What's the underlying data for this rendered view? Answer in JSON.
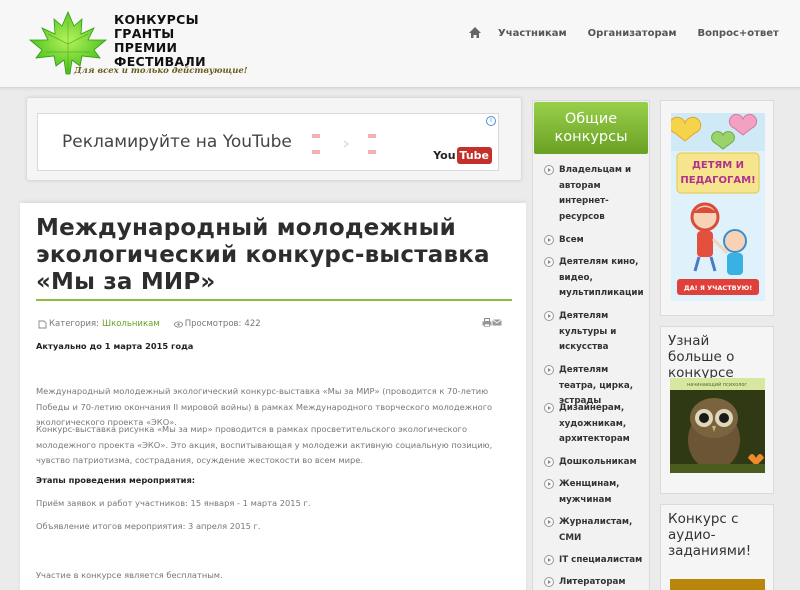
{
  "header": {
    "logo_lines": [
      "КОНКУРСЫ",
      "ГРАНТЫ",
      "ПРЕМИИ",
      "ФЕСТИВАЛИ"
    ],
    "tagline": "Для всех и только действующие!",
    "nav": [
      "Участникам",
      "Организаторам",
      "Вопрос+ответ"
    ]
  },
  "ad": {
    "text": "Рекламируйте на YouTube",
    "you": "You",
    "tube": "Tube",
    "info": "i"
  },
  "article": {
    "title": "Международный молодежный экологический конкурс-выставка «Мы за МИР»",
    "meta": {
      "category_label": "Категория:",
      "category_value": "Школьникам",
      "views_label": "Просмотров:",
      "views_value": "422"
    },
    "paragraphs": [
      "Актуально до 1 марта 2015 года",
      "Международный молодежный экологический конкурс-выставка «Мы за МИР» (проводится к 70-летию Победы и 70-летию окончания II мировой войны) в рамках Международного творческого молодежного экологического проекта «ЭКО».",
      "Конкурс-выставка рисунка «Мы за мир» проводится в рамках просветительского экологического молодежного проекта «ЭКО». Это акция, воспитывающая у молодежи активную социальную позицию, чувство патриотизма, сострадания, осуждение жестокости во всем мире.",
      "Этапы проведения мероприятия:",
      "Приём заявок и работ участников: 15 января - 1 марта 2015 г.",
      "Объявление итогов мероприятия: 3 апреля 2015 г.",
      "Участие в конкурсе является бесплатным."
    ]
  },
  "sidebar_categories": {
    "title": "Общие конкурсы",
    "items": [
      "Владельцам и авторам интернет-ресурсов",
      "Всем",
      "Деятелям кино, видео, мультипликации",
      "Деятелям культуры и искусства",
      "Деятелям театра, цирка, эстрады",
      "Дизайнерам, художникам, архитекторам",
      "Дошкольникам",
      "Женщинам, мужчинам",
      "Журналистам, СМИ",
      "IT специалистам",
      "Литераторам"
    ]
  },
  "right_sidebar": {
    "banner_text_1": "ДЕТЯМ И",
    "banner_text_2": "ПЕДАГОГАМ!",
    "banner_button": "ДА! Я УЧАСТВУЮ!",
    "widget1_title": "Узнай больше о конкурсе",
    "owl_caption": "начинающий психолог",
    "widget2_title": "Конкурс с аудио-заданиями!"
  }
}
